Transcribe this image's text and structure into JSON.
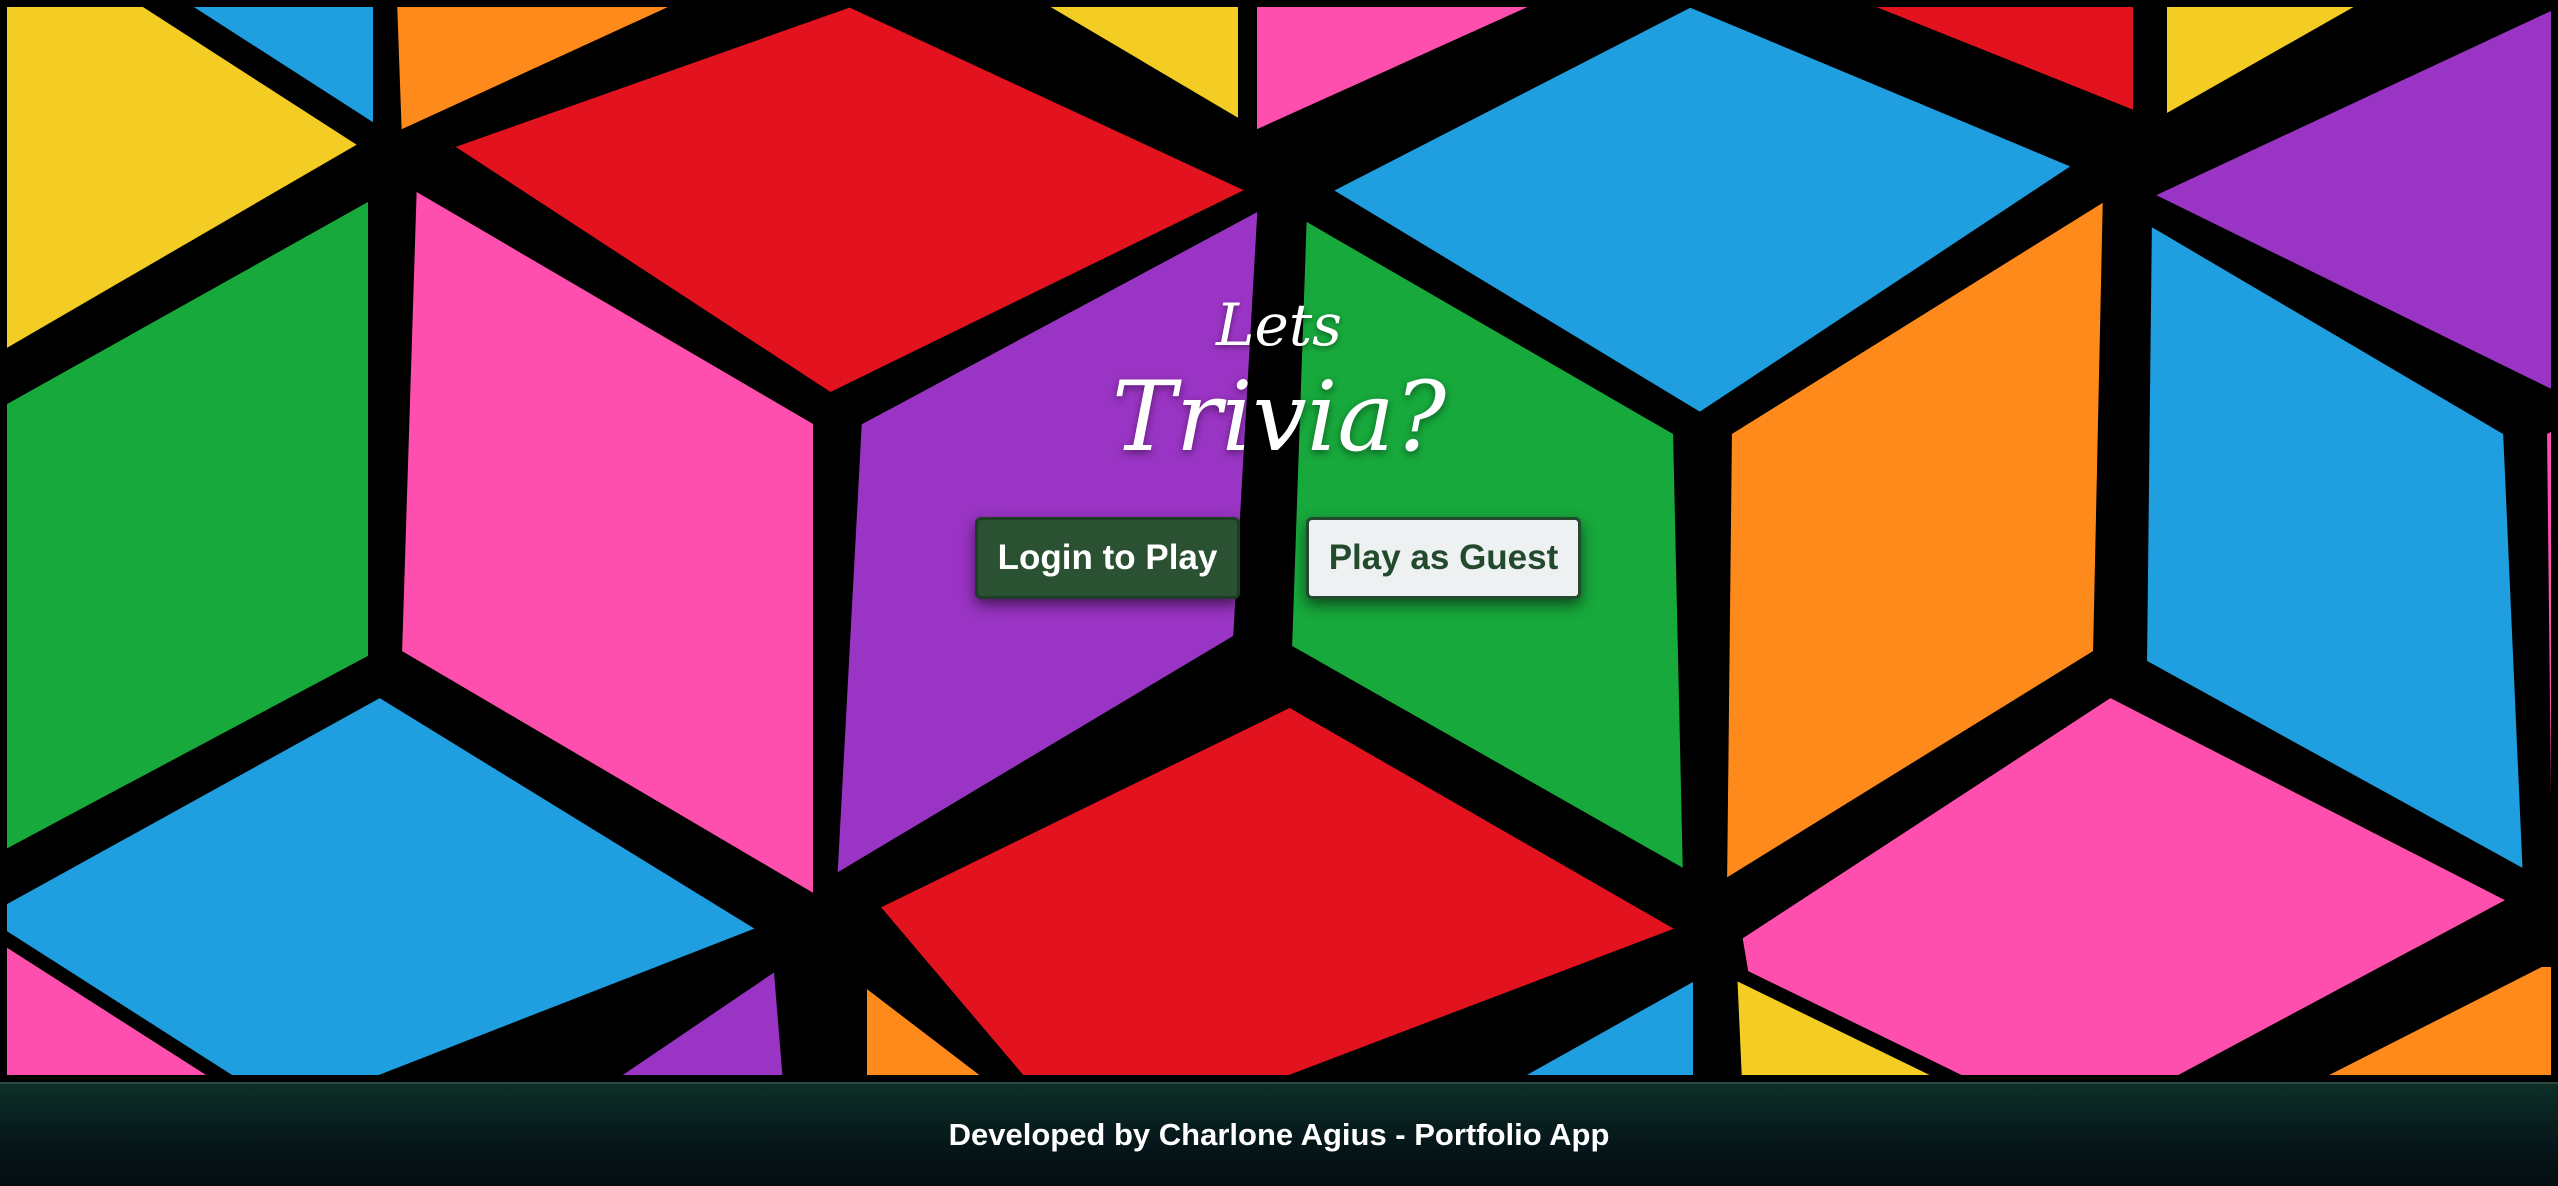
{
  "hero": {
    "title_small": "Lets",
    "title_big": "Trivia?"
  },
  "actions": {
    "login_label": "Login to Play",
    "guest_label": "Play as Guest"
  },
  "footer": {
    "credit": "Developed by Charlone Agius - Portfolio App"
  },
  "colors": {
    "login_bg": "#2b5133",
    "guest_bg": "#eef1f2",
    "guest_text": "#244a2d",
    "footer_bg": "#06161a",
    "paper_red": "#e2121f",
    "paper_pink": "#ff4fae",
    "paper_purple": "#9a34c4",
    "paper_green": "#17a93c",
    "paper_blue": "#1f9ee0",
    "paper_orange": "#ff8a1c",
    "paper_yellow": "#f3cc24"
  }
}
